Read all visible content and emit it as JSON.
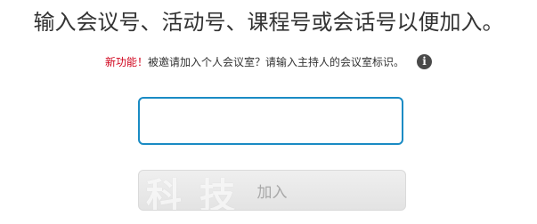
{
  "header": {
    "title": "输入会议号、活动号、课程号或会话号以便加入。"
  },
  "notice": {
    "new_feature": "新功能！",
    "text": "被邀请加入个人会议室？请输入主持人的会议室标识。",
    "info_icon": "info-icon",
    "info_glyph": "i"
  },
  "join_form": {
    "meeting_number_value": "",
    "meeting_number_placeholder": "",
    "join_label": "加入",
    "watermark": "科技"
  },
  "colors": {
    "accent": "#1a8bc4",
    "new_feature": "#d0021b"
  }
}
